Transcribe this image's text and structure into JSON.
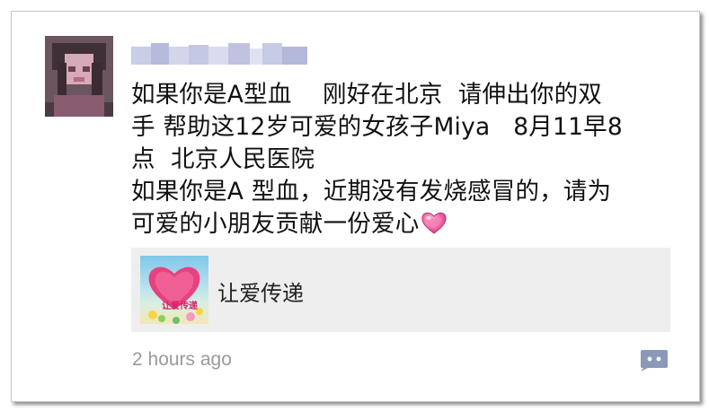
{
  "post": {
    "username_pixelated": "",
    "text_lines": [
      "如果你是A型血    刚好在北京  请伸出你的双",
      "手 帮助这12岁可爱的女孩子Miya   8月11早8",
      "点  北京人民医院",
      "如果你是A 型血，近期没有发烧感冒的，请为",
      "可爱的小朋友贡献一份爱心"
    ],
    "emoji": "pink-heart-icon"
  },
  "link_card": {
    "title": "让爱传递",
    "thumbnail_caption": "让爱传递",
    "thumbnail_icon": "heart-icon"
  },
  "footer": {
    "timestamp": "2 hours ago",
    "comment_icon": "comment-icon"
  },
  "colors": {
    "text": "#111111",
    "timestamp": "#9a9a9a",
    "card_bg": "#eeeeee",
    "comment_icon": "#8c98b8",
    "heart": "#e8417f"
  }
}
